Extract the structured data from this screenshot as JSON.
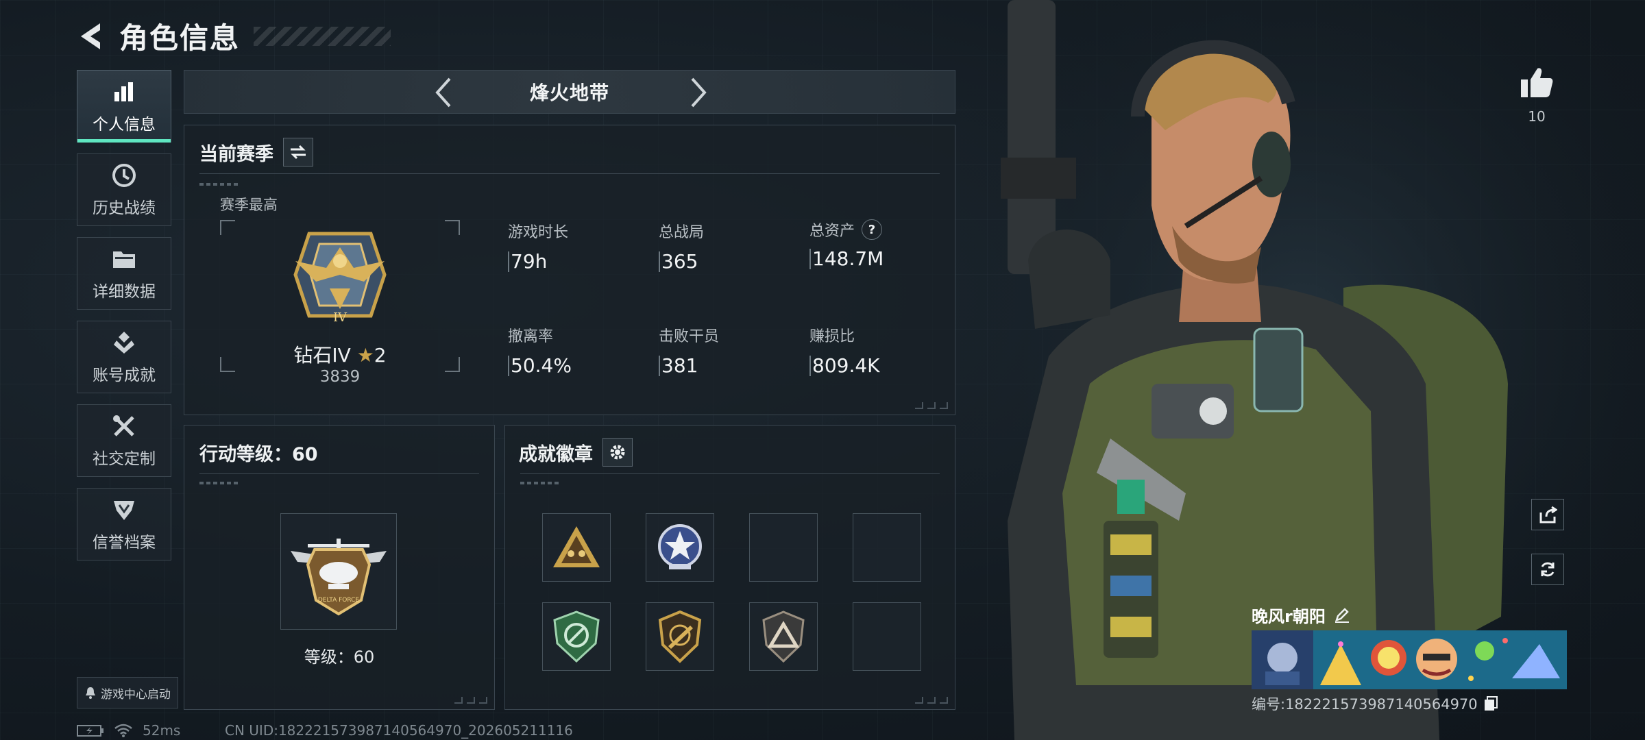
{
  "header": {
    "title": "角色信息"
  },
  "sidebar": {
    "items": [
      {
        "label": "个人信息",
        "icon": "bar-chart-icon",
        "active": true
      },
      {
        "label": "历史战绩",
        "icon": "history-clock-icon",
        "active": false
      },
      {
        "label": "详细数据",
        "icon": "folder-icon",
        "active": false
      },
      {
        "label": "账号成就",
        "icon": "achievement-icon",
        "active": false
      },
      {
        "label": "社交定制",
        "icon": "tools-icon",
        "active": false
      },
      {
        "label": "信誉档案",
        "icon": "credit-shield-icon",
        "active": false
      }
    ],
    "launch_label": "游戏中心启动"
  },
  "mode": {
    "title": "烽火地带"
  },
  "season": {
    "title": "当前赛季",
    "best_label": "赛季最高",
    "rank_name": "钻石IV",
    "rank_stars": "2",
    "rank_score": "3839",
    "stats": [
      {
        "key": "游戏时长",
        "value": "79h"
      },
      {
        "key": "总战局",
        "value": "365"
      },
      {
        "key": "总资产",
        "value": "148.7M",
        "help": "?"
      },
      {
        "key": "撤离率",
        "value": "50.4%"
      },
      {
        "key": "击败干员",
        "value": "381"
      },
      {
        "key": "赚损比",
        "value": "809.4K"
      }
    ]
  },
  "level": {
    "title": "行动等级：60",
    "caption": "等级：60"
  },
  "badges": {
    "title": "成就徽章",
    "slots": [
      {
        "icon": "triangle-squad-badge-icon",
        "color": "#c9a24a"
      },
      {
        "icon": "star-medal-badge-icon",
        "color": "#8fa3c8"
      },
      {
        "icon": "",
        "color": ""
      },
      {
        "icon": "",
        "color": ""
      },
      {
        "icon": "green-shield-badge-icon",
        "color": "#3f8a57"
      },
      {
        "icon": "rifle-shield-badge-icon",
        "color": "#b08a4a"
      },
      {
        "icon": "triangle-emblem-badge-icon",
        "color": "#9a8f80"
      },
      {
        "icon": "",
        "color": ""
      }
    ]
  },
  "character": {
    "likes": "10",
    "player_name": "晚风r朝阳",
    "player_id": "编号:182221573987140564970"
  },
  "status": {
    "ping": "52ms",
    "uid": "CN UID:182221573987140564970_202605211116"
  },
  "colors": {
    "accent": "#5fe6c1",
    "panel_border": "#3a4650",
    "gold": "#c9a24a"
  }
}
